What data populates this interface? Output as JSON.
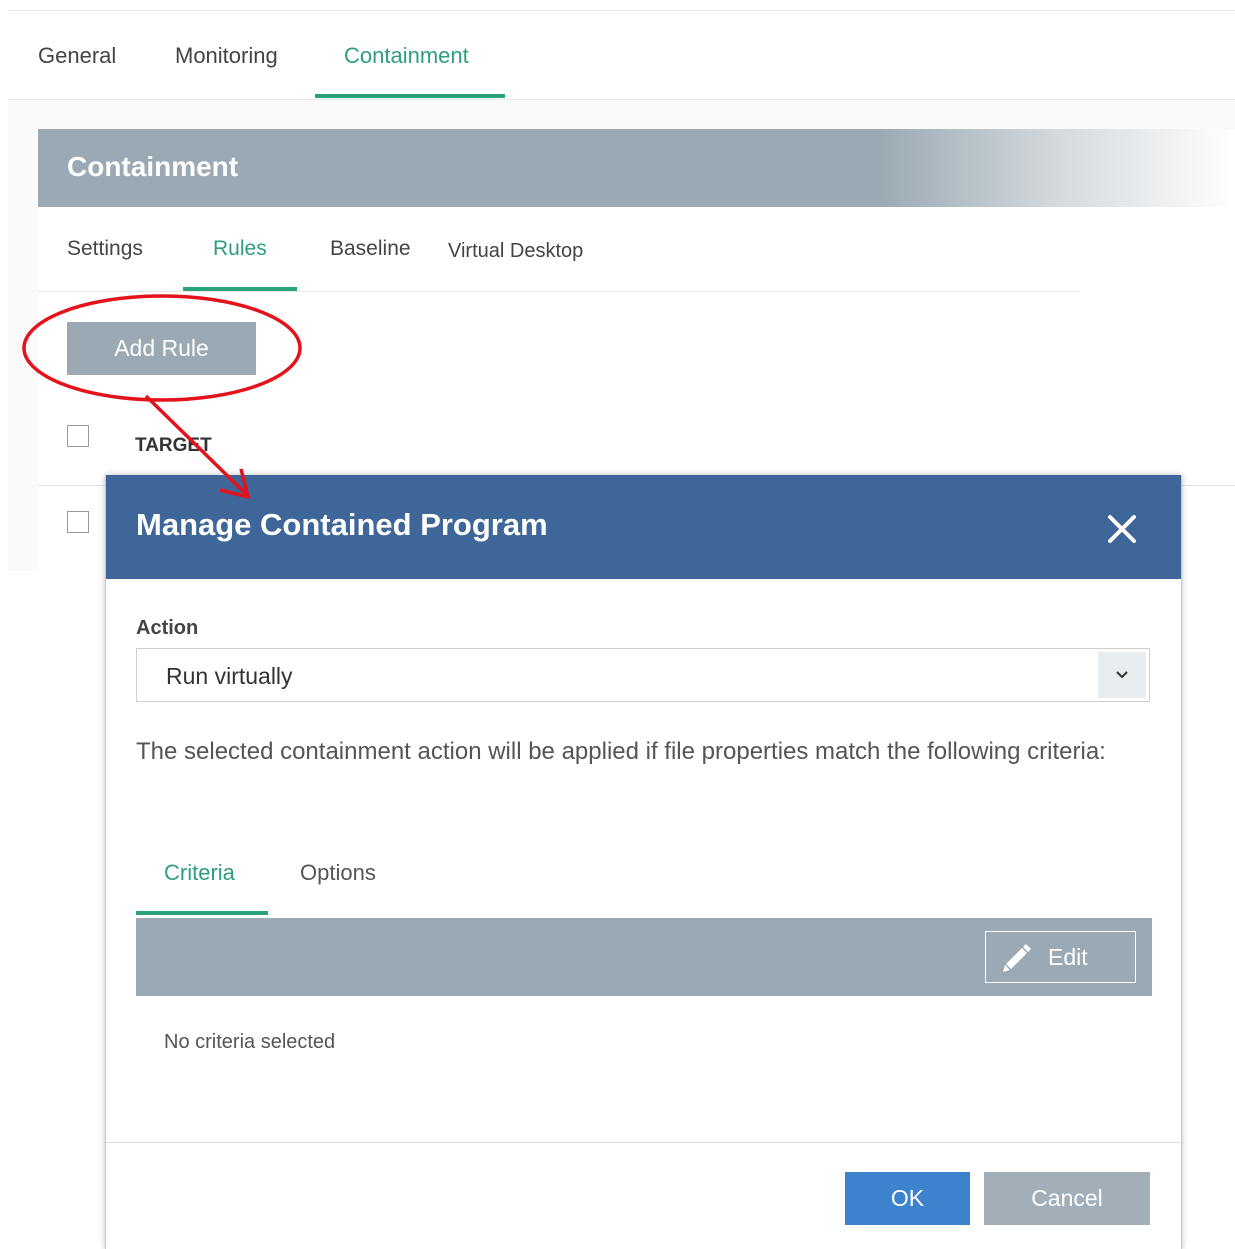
{
  "top_tabs": [
    {
      "label": "General",
      "active": false
    },
    {
      "label": "Monitoring",
      "active": false
    },
    {
      "label": "Containment",
      "active": true
    }
  ],
  "panel": {
    "title": "Containment",
    "sub_tabs": [
      {
        "label": "Settings",
        "active": false
      },
      {
        "label": "Rules",
        "active": true
      },
      {
        "label": "Baseline",
        "active": false
      },
      {
        "label": "Virtual Desktop",
        "active": false
      }
    ],
    "add_rule_label": "Add Rule",
    "table_header": "TARGET"
  },
  "modal": {
    "title": "Manage Contained Program",
    "close_icon": "close-icon",
    "action_label": "Action",
    "action_value": "Run virtually",
    "description": "The selected containment action will be applied if file properties match the following criteria:",
    "tabs": [
      {
        "label": "Criteria",
        "active": true
      },
      {
        "label": "Options",
        "active": false
      }
    ],
    "edit_label": "Edit",
    "edit_icon": "pencil-icon",
    "empty_message": "No criteria selected",
    "ok_label": "OK",
    "cancel_label": "Cancel"
  },
  "colors": {
    "accent_green": "#2aa37c",
    "header_gray": "#9aa9b3",
    "modal_header_blue": "#3e6698",
    "ok_blue": "#3d82cd",
    "annotation_red": "#e3121b"
  }
}
